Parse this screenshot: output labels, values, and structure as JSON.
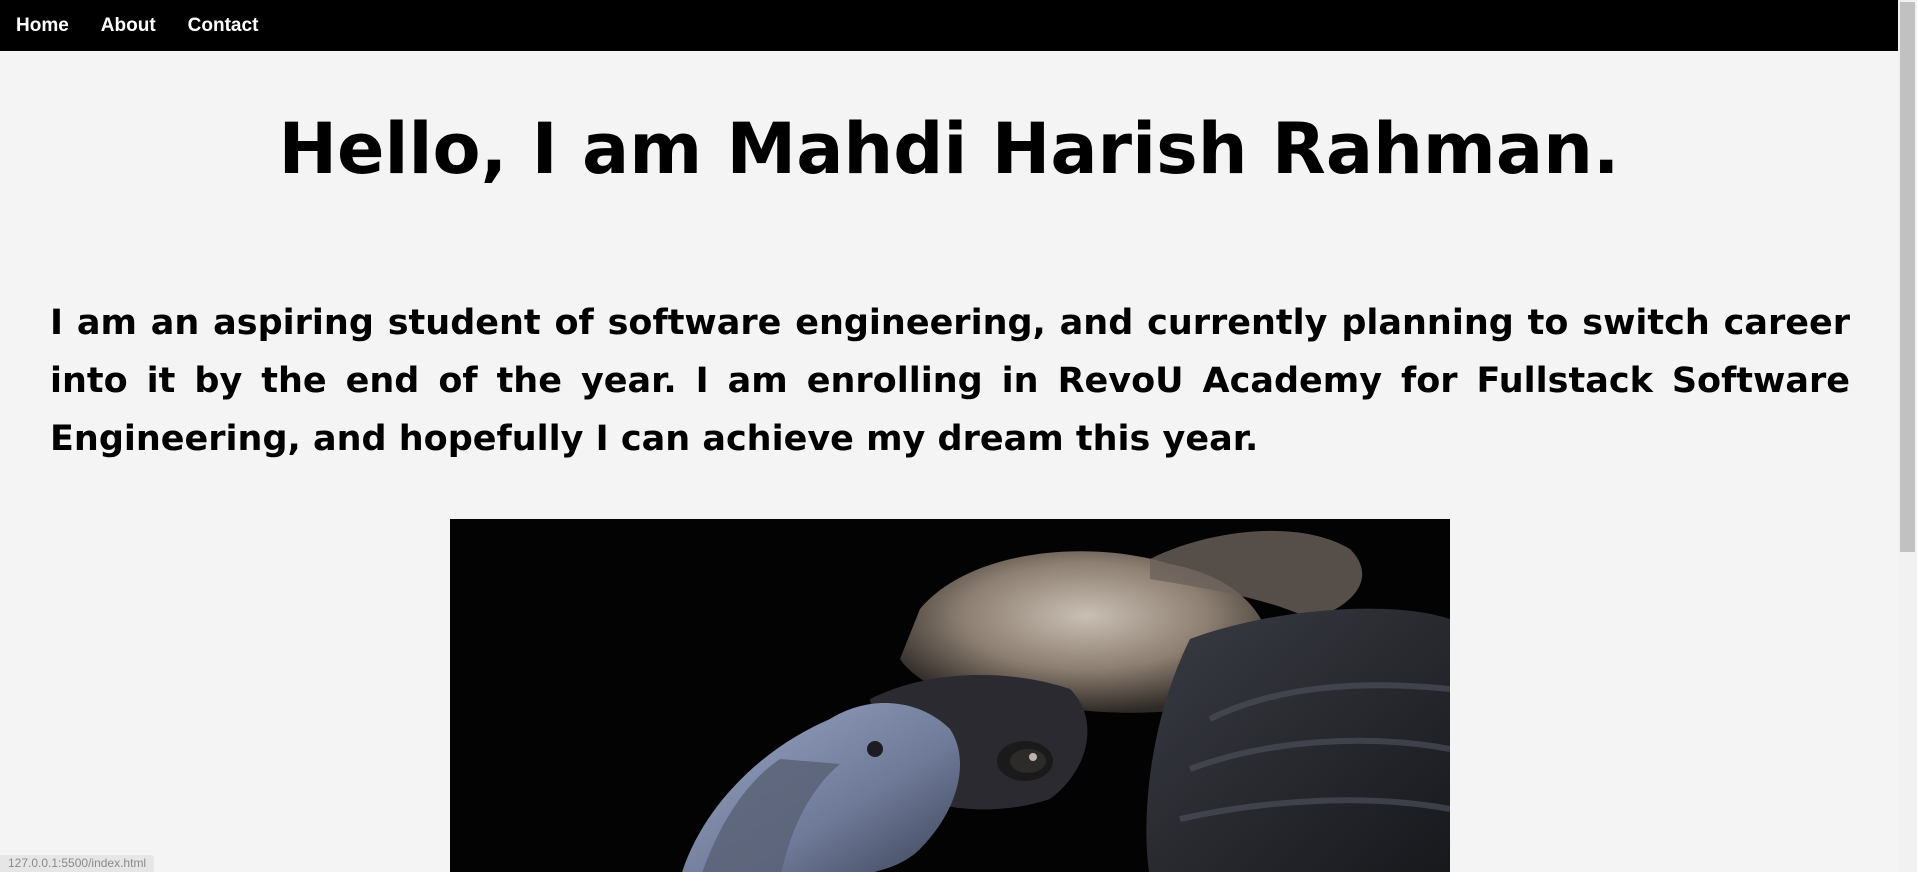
{
  "nav": {
    "items": [
      {
        "label": "Home"
      },
      {
        "label": "About"
      },
      {
        "label": "Contact"
      }
    ]
  },
  "main": {
    "title": "Hello, I am Mahdi Harish Rahman.",
    "bio": "I am an aspiring student of software engineering, and currently planning to switch career into it by the end of the year. I am enrolling in RevoU Academy for Fullstack Software Engineering, and hopefully I can achieve my dream this year.",
    "image_subject": "vulture-photo"
  },
  "status_bar": {
    "url": "127.0.0.1:5500/index.html"
  },
  "colors": {
    "navbar_bg": "#000000",
    "nav_text": "#ffffff",
    "page_bg": "#f4f4f4",
    "text": "#000000"
  }
}
